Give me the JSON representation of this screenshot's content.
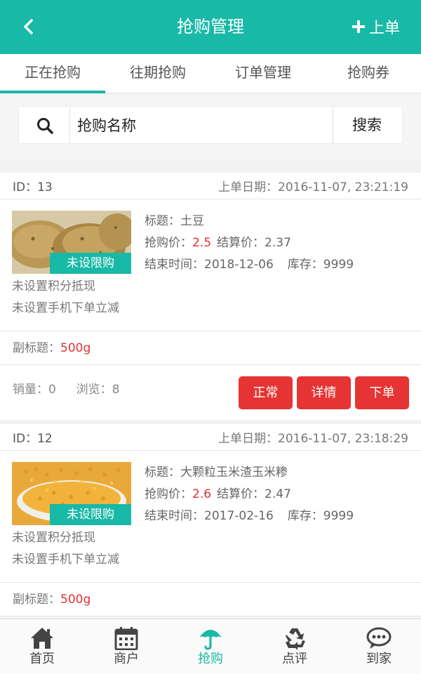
{
  "header": {
    "title": "抢购管理",
    "add_label": "上单"
  },
  "tabs": [
    {
      "label": "正在抢购",
      "active": true
    },
    {
      "label": "往期抢购",
      "active": false
    },
    {
      "label": "订单管理",
      "active": false
    },
    {
      "label": "抢购券",
      "active": false
    }
  ],
  "search": {
    "value": "抢购名称",
    "button_label": "搜索"
  },
  "items": [
    {
      "id_label": "ID：13",
      "date_label": "上单日期：2016-11-07, 23:21:19",
      "badge": "未设限购",
      "title_prefix": "标题：",
      "title": "土豆",
      "price_prefix": "抢购价：",
      "price": "2.5",
      "settle_label": "结算价：2.37",
      "end_label": "结束时间：2018-12-06",
      "stock_label": "库存：9999",
      "note1": "未设置积分抵现",
      "note2": "未设置手机下单立减",
      "subtitle_prefix": "副标题：",
      "subtitle": "500g",
      "sales_label": "销量：0",
      "views_label": "浏览：8",
      "btn_status": "正常",
      "btn_detail": "详情",
      "btn_order": "下单"
    },
    {
      "id_label": "ID：12",
      "date_label": "上单日期：2016-11-07, 23:18:29",
      "badge": "未设限购",
      "title_prefix": "标题：",
      "title": "大颗粒玉米渣玉米糁",
      "price_prefix": "抢购价：",
      "price": "2.6",
      "settle_label": "结算价：2.47",
      "end_label": "结束时间：2017-02-16",
      "stock_label": "库存：9999",
      "note1": "未设置积分抵现",
      "note2": "未设置手机下单立减",
      "subtitle_prefix": "副标题：",
      "subtitle": "500g"
    }
  ],
  "bottom_nav": [
    {
      "label": "首页",
      "icon": "home-icon"
    },
    {
      "label": "商户",
      "icon": "calendar-icon"
    },
    {
      "label": "抢购",
      "icon": "umbrella-icon",
      "active": true
    },
    {
      "label": "点评",
      "icon": "recycle-icon"
    },
    {
      "label": "到家",
      "icon": "chat-icon"
    }
  ],
  "colors": {
    "accent": "#18b9a6",
    "danger": "#e63434",
    "price": "#e03232"
  }
}
